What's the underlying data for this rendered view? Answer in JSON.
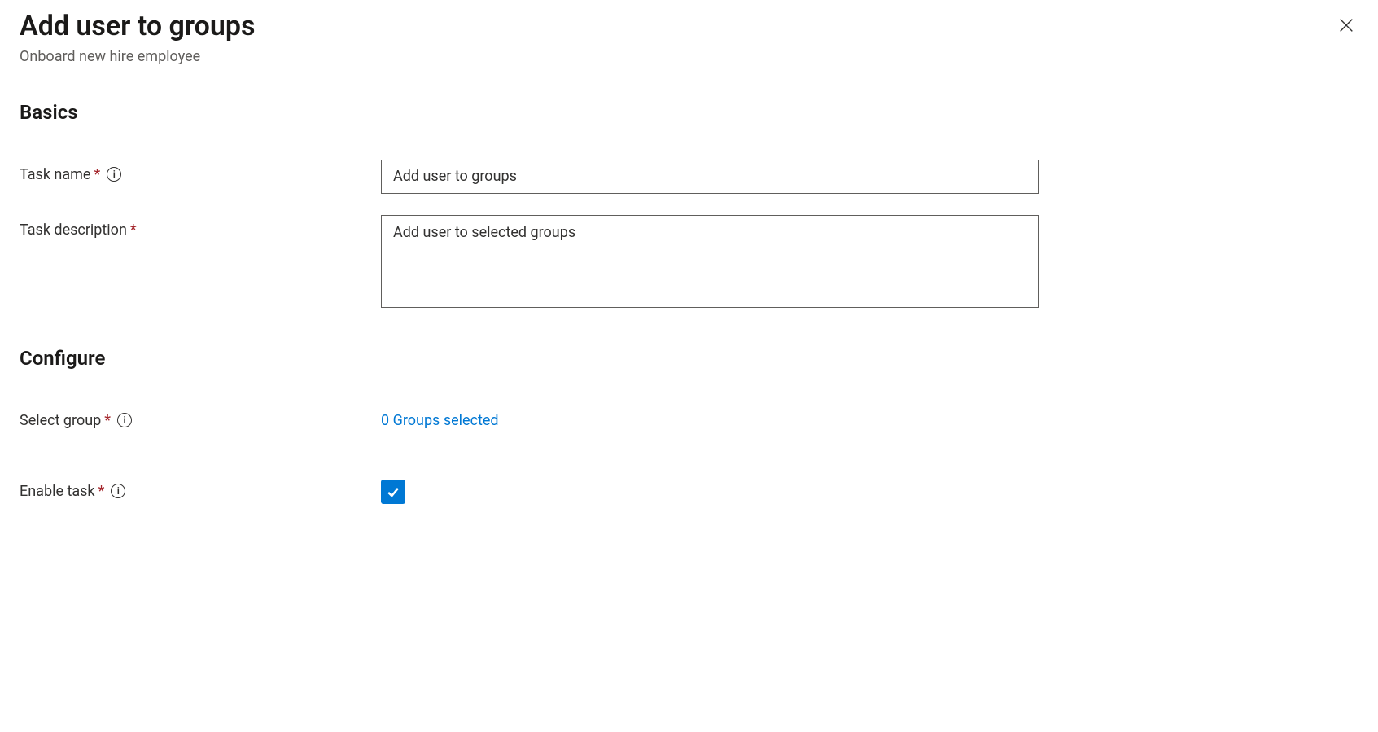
{
  "header": {
    "title": "Add user to groups",
    "subtitle": "Onboard new hire employee"
  },
  "sections": {
    "basics": {
      "heading": "Basics",
      "task_name_label": "Task name",
      "task_name_value": "Add user to groups",
      "task_description_label": "Task description",
      "task_description_value": "Add user to selected groups"
    },
    "configure": {
      "heading": "Configure",
      "select_group_label": "Select group",
      "select_group_value": "0 Groups selected",
      "enable_task_label": "Enable task",
      "enable_task_checked": true
    }
  }
}
